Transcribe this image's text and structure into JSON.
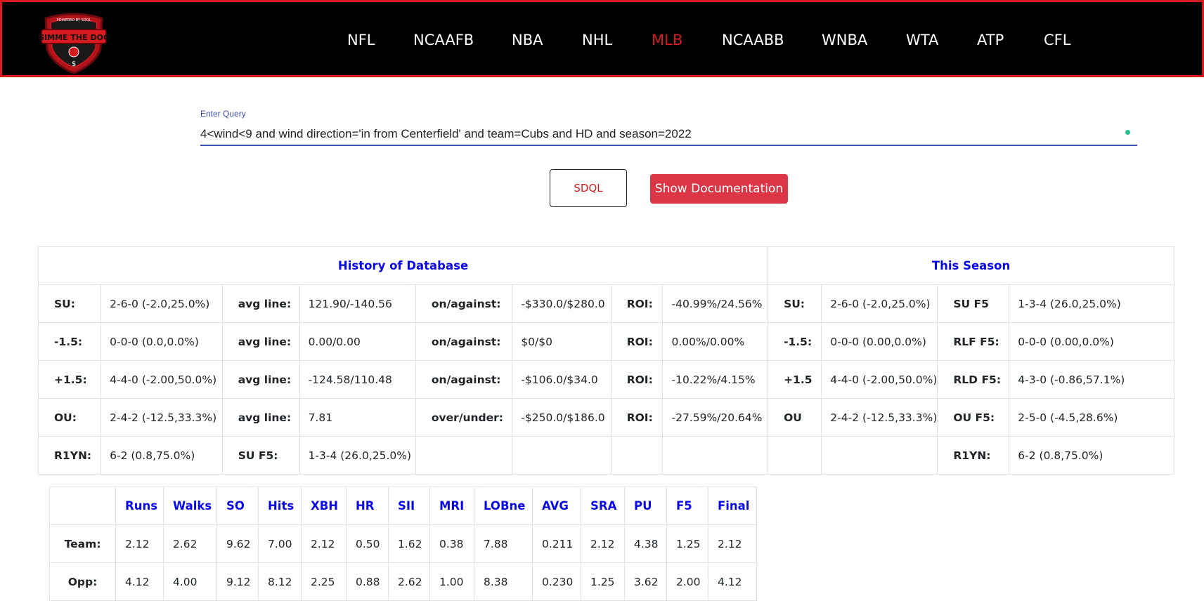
{
  "nav": {
    "logo_text": "GIMME THE DOG",
    "logo_subtext": "POWERED BY SDQL",
    "items": [
      "NFL",
      "NCAAFB",
      "NBA",
      "NHL",
      "MLB",
      "NCAABB",
      "WNBA",
      "WTA",
      "ATP",
      "CFL"
    ],
    "active": "MLB"
  },
  "query": {
    "label": "Enter Query",
    "value": "4<wind<9 and wind direction='in from Centerfield' and team=Cubs and HD and season=2022"
  },
  "buttons": {
    "sdql": "SDQL",
    "documentation": "Show Documentation"
  },
  "stats": {
    "history_title": "History of Database",
    "season_title": "This Season",
    "rows": [
      [
        "SU:",
        "2-6-0 (-2.0,25.0%)",
        "avg line:",
        "121.90/-140.56",
        "on/against:",
        "-$330.0/$280.0",
        "ROI:",
        "-40.99%/24.56%",
        "SU:",
        "2-6-0 (-2.0,25.0%)",
        "SU F5",
        "1-3-4 (26.0,25.0%)"
      ],
      [
        "-1.5:",
        "0-0-0 (0.0,0.0%)",
        "avg line:",
        "0.00/0.00",
        "on/against:",
        "$0/$0",
        "ROI:",
        "0.00%/0.00%",
        "-1.5:",
        "0-0-0 (0.00,0.0%)",
        "RLF F5:",
        "0-0-0 (0.00,0.0%)"
      ],
      [
        "+1.5:",
        "4-4-0 (-2.00,50.0%)",
        "avg line:",
        "-124.58/110.48",
        "on/against:",
        "-$106.0/$34.0",
        "ROI:",
        "-10.22%/4.15%",
        "+1.5",
        "4-4-0 (-2.00,50.0%)",
        "RLD F5:",
        "4-3-0 (-0.86,57.1%)"
      ],
      [
        "OU:",
        "2-4-2 (-12.5,33.3%)",
        "avg line:",
        "7.81",
        "over/under:",
        "-$250.0/$186.0",
        "ROI:",
        "-27.59%/20.64%",
        "OU",
        "2-4-2 (-12.5,33.3%)",
        "OU F5:",
        "2-5-0 (-4.5,28.6%)"
      ],
      [
        "R1YN:",
        "6-2 (0.8,75.0%)",
        "SU F5:",
        "1-3-4 (26.0,25.0%)",
        "",
        "",
        "",
        "",
        "",
        "",
        "R1YN:",
        "6-2 (0.8,75.0%)"
      ]
    ]
  },
  "game_stats": {
    "headers": [
      "",
      "Runs",
      "Walks",
      "SO",
      "Hits",
      "XBH",
      "HR",
      "SII",
      "MRI",
      "LOBne",
      "AVG",
      "SRA",
      "PU",
      "F5",
      "Final"
    ],
    "rows": [
      [
        "Team:",
        "2.12",
        "2.62",
        "9.62",
        "7.00",
        "2.12",
        "0.50",
        "1.62",
        "0.38",
        "7.88",
        "0.211",
        "2.12",
        "4.38",
        "1.25",
        "2.12"
      ],
      [
        "Opp:",
        "4.12",
        "4.00",
        "9.12",
        "8.12",
        "2.25",
        "0.88",
        "2.62",
        "1.00",
        "8.38",
        "0.230",
        "1.25",
        "3.62",
        "2.00",
        "4.12"
      ]
    ]
  },
  "colors": {
    "brand_red": "#d71920",
    "header_blue": "#0a0ae6",
    "button_red": "#dc3545"
  }
}
